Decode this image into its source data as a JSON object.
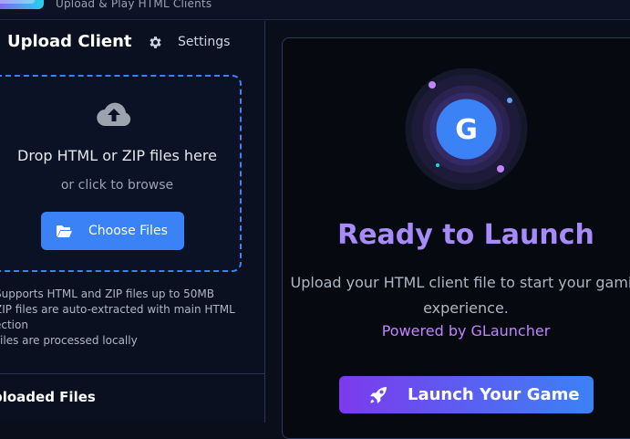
{
  "header": {
    "tagline": "Upload & Play HTML Clients"
  },
  "sidebar": {
    "title": "Upload Client",
    "settings_label": "Settings",
    "settings_icon": "gear-icon",
    "dropzone": {
      "icon": "cloud-upload-icon",
      "title": "Drop HTML or ZIP files here",
      "subtitle": "or click to browse",
      "button_label": "Choose Files",
      "button_icon": "folder-open-icon"
    },
    "notes": [
      "Supports HTML and ZIP files up to 50MB",
      "ZIP files are auto-extracted with main HTML",
      "ection",
      "Files are processed locally"
    ],
    "uploaded_title": "ploaded Files"
  },
  "main": {
    "badge_letter": "G",
    "title": "Ready to Launch",
    "description": "Upload your HTML client file to start your gamin\nexperience.",
    "powered_by": "Powered by GLauncher",
    "launch_label": "Launch Your Game",
    "launch_icon": "rocket-icon"
  },
  "colors": {
    "accent_blue": "#3b82f6",
    "accent_purple": "#a78bfa",
    "powered_purple": "#c084fc",
    "background": "#0a0e1a"
  }
}
